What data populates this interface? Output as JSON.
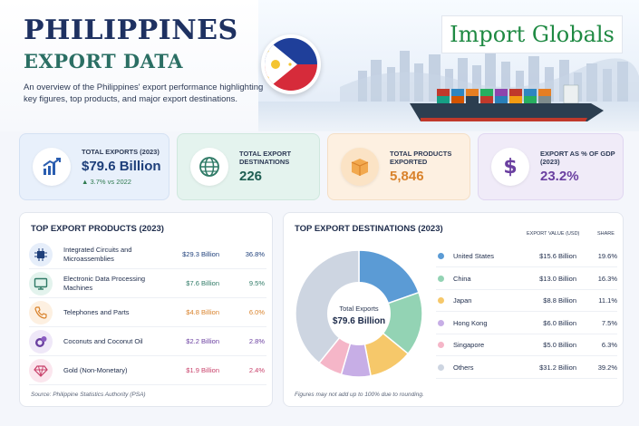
{
  "header": {
    "title_line1": "PHILIPPINES",
    "title_line2": "EXPORT DATA",
    "subtitle": "An overview of the Philippines' export performance highlighting key figures, top products, and major export destinations.",
    "brand": "Import Globals"
  },
  "kpis": [
    {
      "label": "TOTAL EXPORTS (2023)",
      "value": "$79.6 Billion",
      "delta": "▲ 3.7% vs 2022",
      "icon": "chart-up-icon"
    },
    {
      "label": "TOTAL EXPORT DESTINATIONS",
      "value": "226",
      "icon": "globe-icon"
    },
    {
      "label": "TOTAL PRODUCTS EXPORTED",
      "value": "5,846",
      "icon": "box-icon"
    },
    {
      "label": "EXPORT AS % OF GDP (2023)",
      "value": "23.2%",
      "icon": "dollar-icon"
    }
  ],
  "products": {
    "title": "TOP EXPORT PRODUCTS (2023)",
    "source": "Source: Philippine Statistics Authority (PSA)",
    "items": [
      {
        "name": "Integrated Circuits and Microassemblies",
        "value": "$29.3 Billion",
        "share": "36.8%",
        "icon": "chip-icon",
        "color": "#1e3f7a",
        "bg": "#e6eefa"
      },
      {
        "name": "Electronic Data Processing Machines",
        "value": "$7.6 Billion",
        "share": "9.5%",
        "icon": "monitor-icon",
        "color": "#2f7a66",
        "bg": "#e3f3ed"
      },
      {
        "name": "Telephones and Parts",
        "value": "$4.8 Billion",
        "share": "6.0%",
        "icon": "phone-icon",
        "color": "#d9822b",
        "bg": "#fdf0e1"
      },
      {
        "name": "Coconuts and Coconut Oil",
        "value": "$2.2 Billion",
        "share": "2.8%",
        "icon": "coconut-icon",
        "color": "#6a3fa0",
        "bg": "#efe8f8"
      },
      {
        "name": "Gold (Non-Monetary)",
        "value": "$1.9 Billion",
        "share": "2.4%",
        "icon": "gem-icon",
        "color": "#c8406a",
        "bg": "#fbe6ee"
      }
    ]
  },
  "destinations": {
    "title": "TOP EXPORT DESTINATIONS (2023)",
    "col_value": "EXPORT VALUE (USD)",
    "col_share": "SHARE",
    "center_label": "Total Exports",
    "center_value": "$79.6 Billion",
    "note": "Figures may not add up to 100% due to rounding.",
    "items": [
      {
        "name": "United States",
        "value": "$15.6 Billion",
        "share": "19.6%",
        "color": "#5b9bd5"
      },
      {
        "name": "China",
        "value": "$13.0 Billion",
        "share": "16.3%",
        "color": "#93d3b4"
      },
      {
        "name": "Japan",
        "value": "$8.8 Billion",
        "share": "11.1%",
        "color": "#f6c86a"
      },
      {
        "name": "Hong Kong",
        "value": "$6.0 Billion",
        "share": "7.5%",
        "color": "#c7aee6"
      },
      {
        "name": "Singapore",
        "value": "$5.0 Billion",
        "share": "6.3%",
        "color": "#f5b6c8"
      },
      {
        "name": "Others",
        "value": "$31.2 Billion",
        "share": "39.2%",
        "color": "#cdd5e1"
      }
    ]
  },
  "chart_data": {
    "type": "pie",
    "title": "TOP EXPORT DESTINATIONS (2023)",
    "categories": [
      "United States",
      "China",
      "Japan",
      "Hong Kong",
      "Singapore",
      "Others"
    ],
    "values": [
      19.6,
      16.3,
      11.1,
      7.5,
      6.3,
      39.2
    ],
    "unit": "%"
  }
}
